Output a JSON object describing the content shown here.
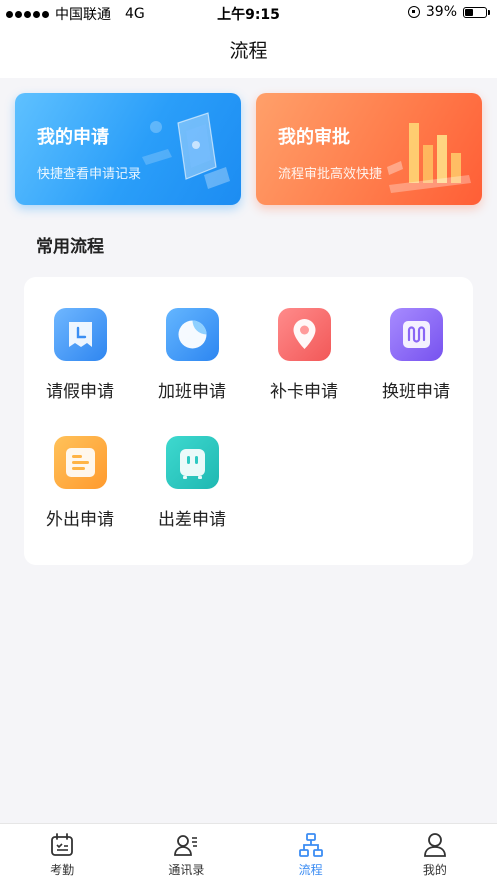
{
  "status_bar": {
    "carrier": "中国联通",
    "network": "4G",
    "time": "上午9:15",
    "battery_percent": "39%",
    "battery_level": 0.39
  },
  "header": {
    "title": "流程"
  },
  "cards": {
    "apply": {
      "title": "我的申请",
      "subtitle": "快捷查看申请记录",
      "colors": [
        "#5fc1ff",
        "#1c8cf2"
      ]
    },
    "approve": {
      "title": "我的审批",
      "subtitle": "流程审批高效快捷",
      "colors": [
        "#ffa06a",
        "#ff5e36"
      ]
    }
  },
  "section": {
    "title": "常用流程"
  },
  "flows": [
    {
      "label": "请假申请",
      "icon": "leave-icon",
      "color": "#4a9cf7"
    },
    {
      "label": "加班申请",
      "icon": "overtime-icon",
      "color": "#3f9ff8"
    },
    {
      "label": "补卡申请",
      "icon": "location-pin-icon",
      "color": "#f56b6b"
    },
    {
      "label": "换班申请",
      "icon": "shift-swap-icon",
      "color": "#8b6cf6"
    },
    {
      "label": "外出申请",
      "icon": "outing-icon",
      "color": "#ffae42"
    },
    {
      "label": "出差申请",
      "icon": "business-trip-icon",
      "color": "#2ccbc4"
    }
  ],
  "tabs": [
    {
      "label": "考勤",
      "icon": "calendar-icon",
      "active": false
    },
    {
      "label": "通讯录",
      "icon": "contacts-icon",
      "active": false
    },
    {
      "label": "流程",
      "icon": "flow-chart-icon",
      "active": true
    },
    {
      "label": "我的",
      "icon": "person-icon",
      "active": false
    }
  ],
  "accent_color": "#3b8cf3"
}
